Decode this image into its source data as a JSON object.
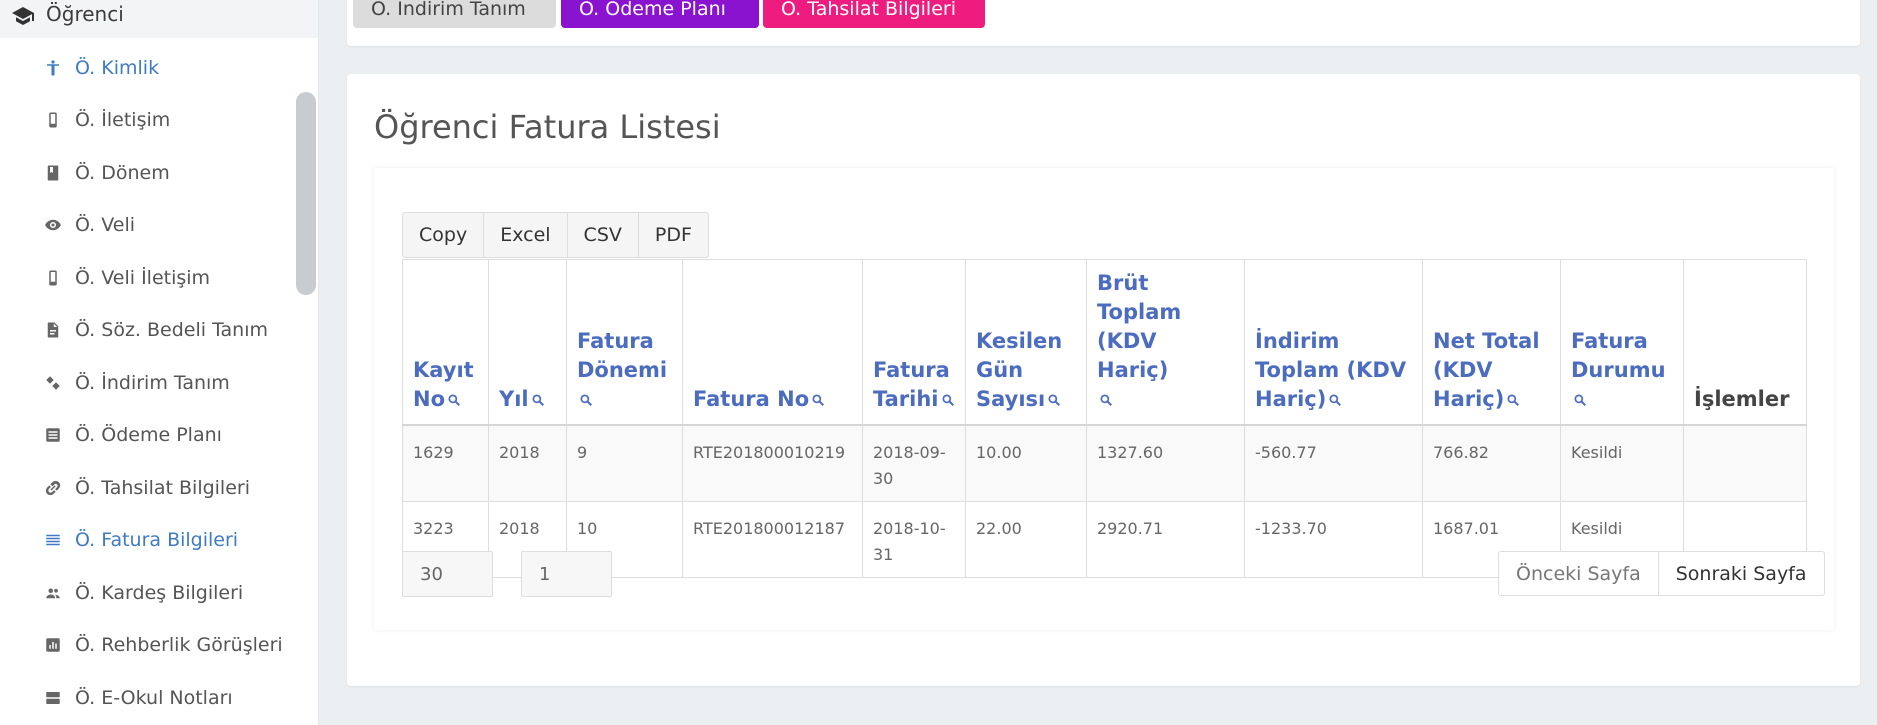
{
  "sidebar": {
    "header": {
      "label": "Öğrenci",
      "icon": "graduation-cap-icon"
    },
    "items": [
      {
        "label": "Ö. Kimlik",
        "icon": "person-icon",
        "active": true
      },
      {
        "label": "Ö. İletişim",
        "icon": "phone-icon",
        "active": false
      },
      {
        "label": "Ö. Dönem",
        "icon": "book-icon",
        "active": false
      },
      {
        "label": "Ö. Veli",
        "icon": "eye-icon",
        "active": false
      },
      {
        "label": "Ö. Veli İletişim",
        "icon": "phone-icon",
        "active": false
      },
      {
        "label": "Ö. Söz. Bedeli Tanım",
        "icon": "document-icon",
        "active": false
      },
      {
        "label": "Ö. İndirim Tanım",
        "icon": "discount-icon",
        "active": false
      },
      {
        "label": "Ö. Ödeme Planı",
        "icon": "list-icon",
        "active": false
      },
      {
        "label": "Ö. Tahsilat Bilgileri",
        "icon": "link-icon",
        "active": false
      },
      {
        "label": "Ö. Fatura Bilgileri",
        "icon": "lines-icon",
        "active": true
      },
      {
        "label": "Ö. Kardeş Bilgileri",
        "icon": "people-icon",
        "active": false
      },
      {
        "label": "Ö. Rehberlik Görüşleri",
        "icon": "chart-icon",
        "active": false
      },
      {
        "label": "Ö. E-Okul Notları",
        "icon": "storage-icon",
        "active": false
      }
    ]
  },
  "top_buttons": [
    {
      "label": "Ö. İndirim Tanım",
      "color": "#dcdcdc"
    },
    {
      "label": "Ö. Ödeme Planı",
      "color": "#8a13cf"
    },
    {
      "label": "Ö. Tahsilat Bilgileri",
      "color": "#ee1c7e"
    }
  ],
  "page": {
    "title": "Öğrenci Fatura Listesi"
  },
  "export_buttons": [
    "Copy",
    "Excel",
    "CSV",
    "PDF"
  ],
  "table": {
    "columns": [
      "Kayıt No",
      "Yıl",
      "Fatura Dönemi",
      "Fatura No",
      "Fatura Tarihi",
      "Kesilen Gün Sayısı",
      "Brüt Toplam (KDV Hariç)",
      "İndirim Toplam (KDV Hariç)",
      "Net Total (KDV Hariç)",
      "Fatura Durumu",
      "İşlemler"
    ],
    "rows": [
      [
        "1629",
        "2018",
        "9",
        "RTE201800010219",
        "2018-09-30",
        "10.00",
        "1327.60",
        "-560.77",
        "766.82",
        "Kesildi",
        ""
      ],
      [
        "3223",
        "2018",
        "10",
        "RTE201800012187",
        "2018-10-31",
        "22.00",
        "2920.71",
        "-1233.70",
        "1687.01",
        "Kesildi",
        ""
      ]
    ]
  },
  "pagination": {
    "page_size": "30",
    "page_number": "1",
    "prev_label": "Önceki Sayfa",
    "next_label": "Sonraki Sayfa"
  }
}
